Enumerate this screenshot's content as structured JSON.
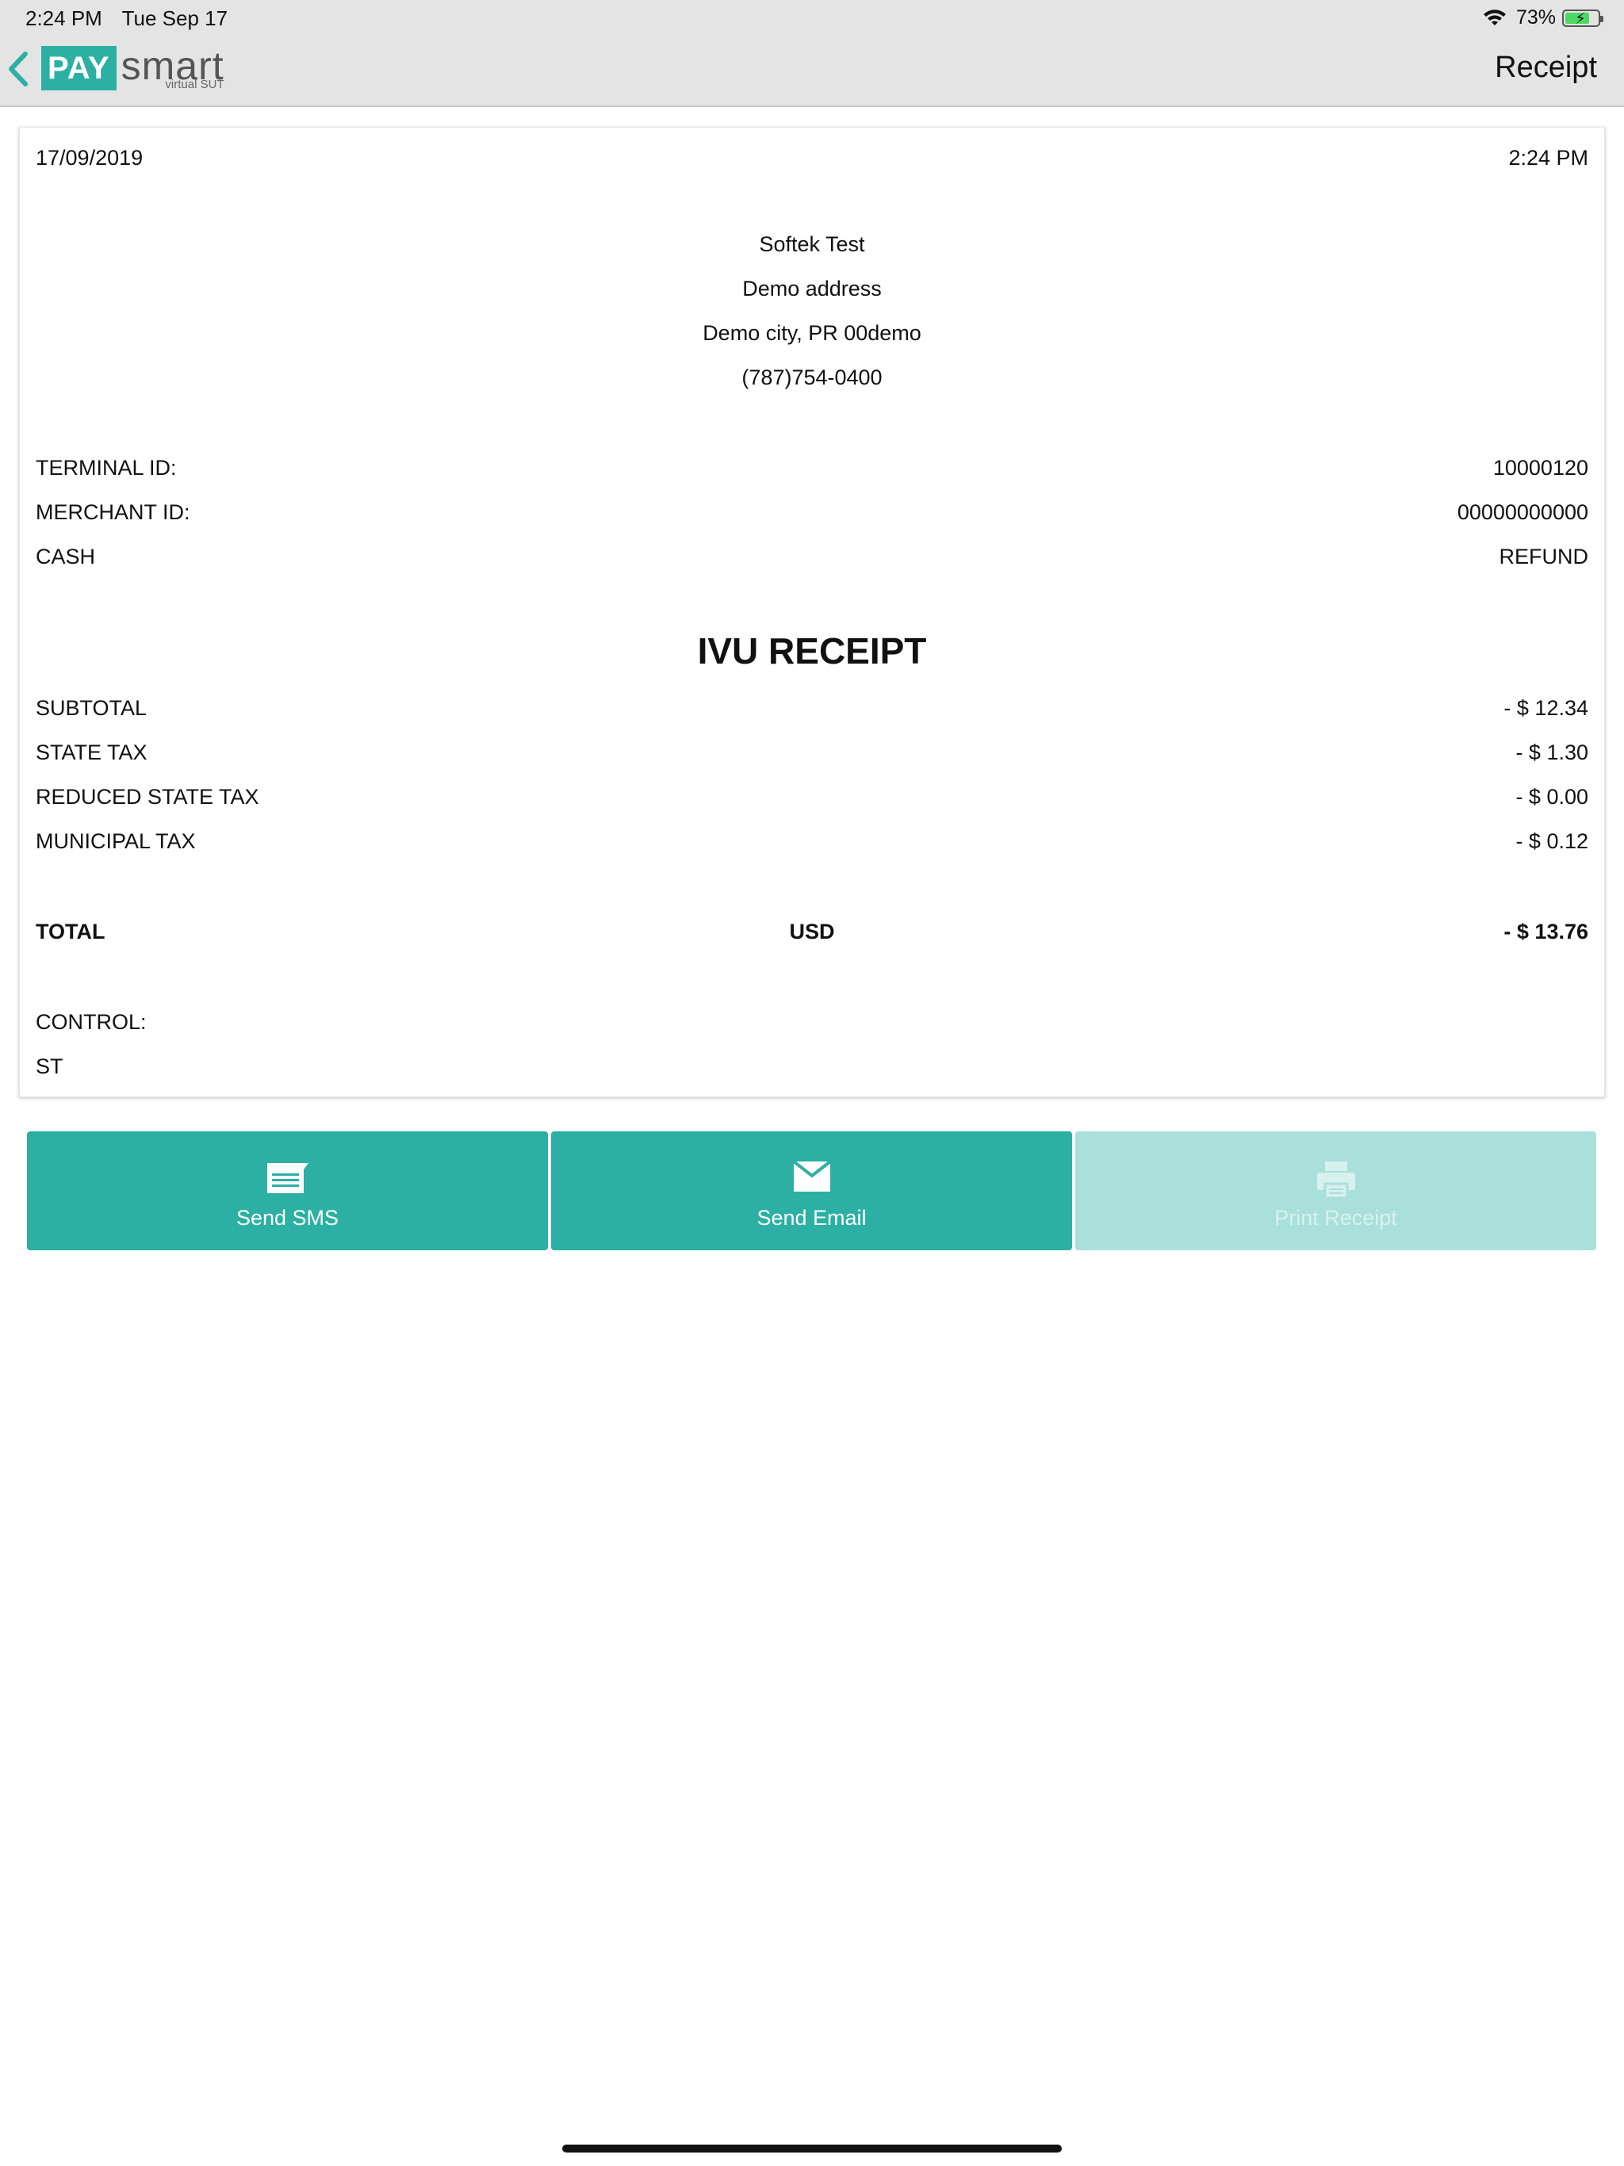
{
  "status_bar": {
    "time": "2:24 PM",
    "date": "Tue Sep 17",
    "battery": "73%",
    "battery_level": 0.73
  },
  "nav": {
    "logo_pay": "PAY",
    "logo_smart": "smart",
    "logo_sub": "virtual SUT",
    "title": "Receipt"
  },
  "receipt": {
    "date": "17/09/2019",
    "time": "2:24 PM",
    "merchant": {
      "name": "Softek Test",
      "address": "Demo address",
      "city": "Demo city, PR 00demo",
      "phone": "(787)754-0400"
    },
    "terminal_label": "TERMINAL ID:",
    "terminal_id": "10000120",
    "merchant_label": "MERCHANT ID:",
    "merchant_id": "00000000000",
    "payment_type": "CASH",
    "transaction_type": "REFUND",
    "title": "IVU RECEIPT",
    "lines": [
      {
        "label": "SUBTOTAL",
        "amount": "- $ 12.34"
      },
      {
        "label": "STATE TAX",
        "amount": "- $ 1.30"
      },
      {
        "label": "REDUCED STATE TAX",
        "amount": "- $ 0.00"
      },
      {
        "label": "MUNICIPAL TAX",
        "amount": "- $ 0.12"
      }
    ],
    "total": {
      "label": "TOTAL",
      "currency": "USD",
      "amount": "- $ 13.76"
    },
    "control_label": "CONTROL:",
    "control_value": "ST"
  },
  "actions": {
    "sms": "Send SMS",
    "email": "Send Email",
    "print": "Print Receipt"
  },
  "colors": {
    "accent": "#2bb0a3",
    "accent_disabled": "#a9e0db"
  }
}
